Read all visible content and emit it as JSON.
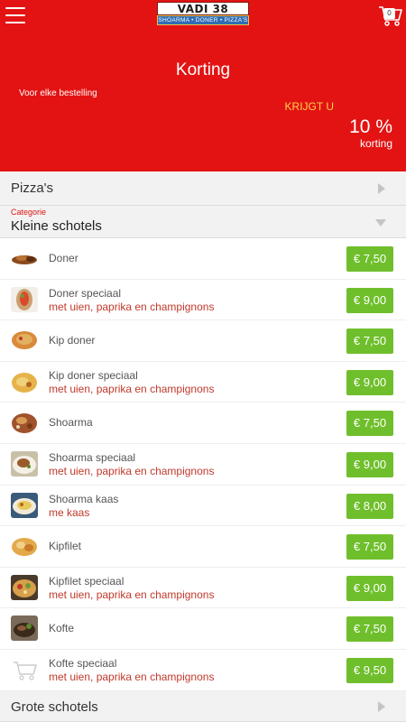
{
  "header": {
    "logo_title": "VADI 38",
    "logo_subtitle": "SHOARMA • DONER • PIZZA'S",
    "cart_count": "0"
  },
  "hero": {
    "title": "Korting",
    "subtitle": "Voor elke bestelling",
    "krijgt": "KRIJGT U",
    "percent": "10 %",
    "korting": "korting"
  },
  "sections": {
    "pizza": "Pizza's",
    "kleine_category": "Categorie",
    "kleine": "Kleine schotels",
    "grote": "Grote schotels"
  },
  "items": [
    {
      "name": "Doner",
      "desc": "",
      "price": "€ 7,50"
    },
    {
      "name": "Doner speciaal",
      "desc": "met uien, paprika en champignons",
      "price": "€ 9,00"
    },
    {
      "name": "Kip doner",
      "desc": "",
      "price": "€ 7,50"
    },
    {
      "name": "Kip doner speciaal",
      "desc": "met uien, paprika en champignons",
      "price": "€ 9,00"
    },
    {
      "name": "Shoarma",
      "desc": "",
      "price": "€ 7,50"
    },
    {
      "name": "Shoarma speciaal",
      "desc": "met uien, paprika en champignons",
      "price": "€ 9,00"
    },
    {
      "name": "Shoarma kaas",
      "desc": "me kaas",
      "price": "€ 8,00"
    },
    {
      "name": "Kipfilet",
      "desc": "",
      "price": "€ 7,50"
    },
    {
      "name": "Kipfilet speciaal",
      "desc": "met uien, paprika en champignons",
      "price": "€ 9,00"
    },
    {
      "name": "Kofte",
      "desc": "",
      "price": "€ 7,50"
    },
    {
      "name": "Kofte speciaal",
      "desc": "met uien, paprika en champignons",
      "price": "€ 9,50"
    }
  ],
  "colors": {
    "brand_red": "#e31313",
    "price_green": "#6fbf2c",
    "desc_red": "#c0392b",
    "krijgt_yellow": "#ffd34a"
  }
}
